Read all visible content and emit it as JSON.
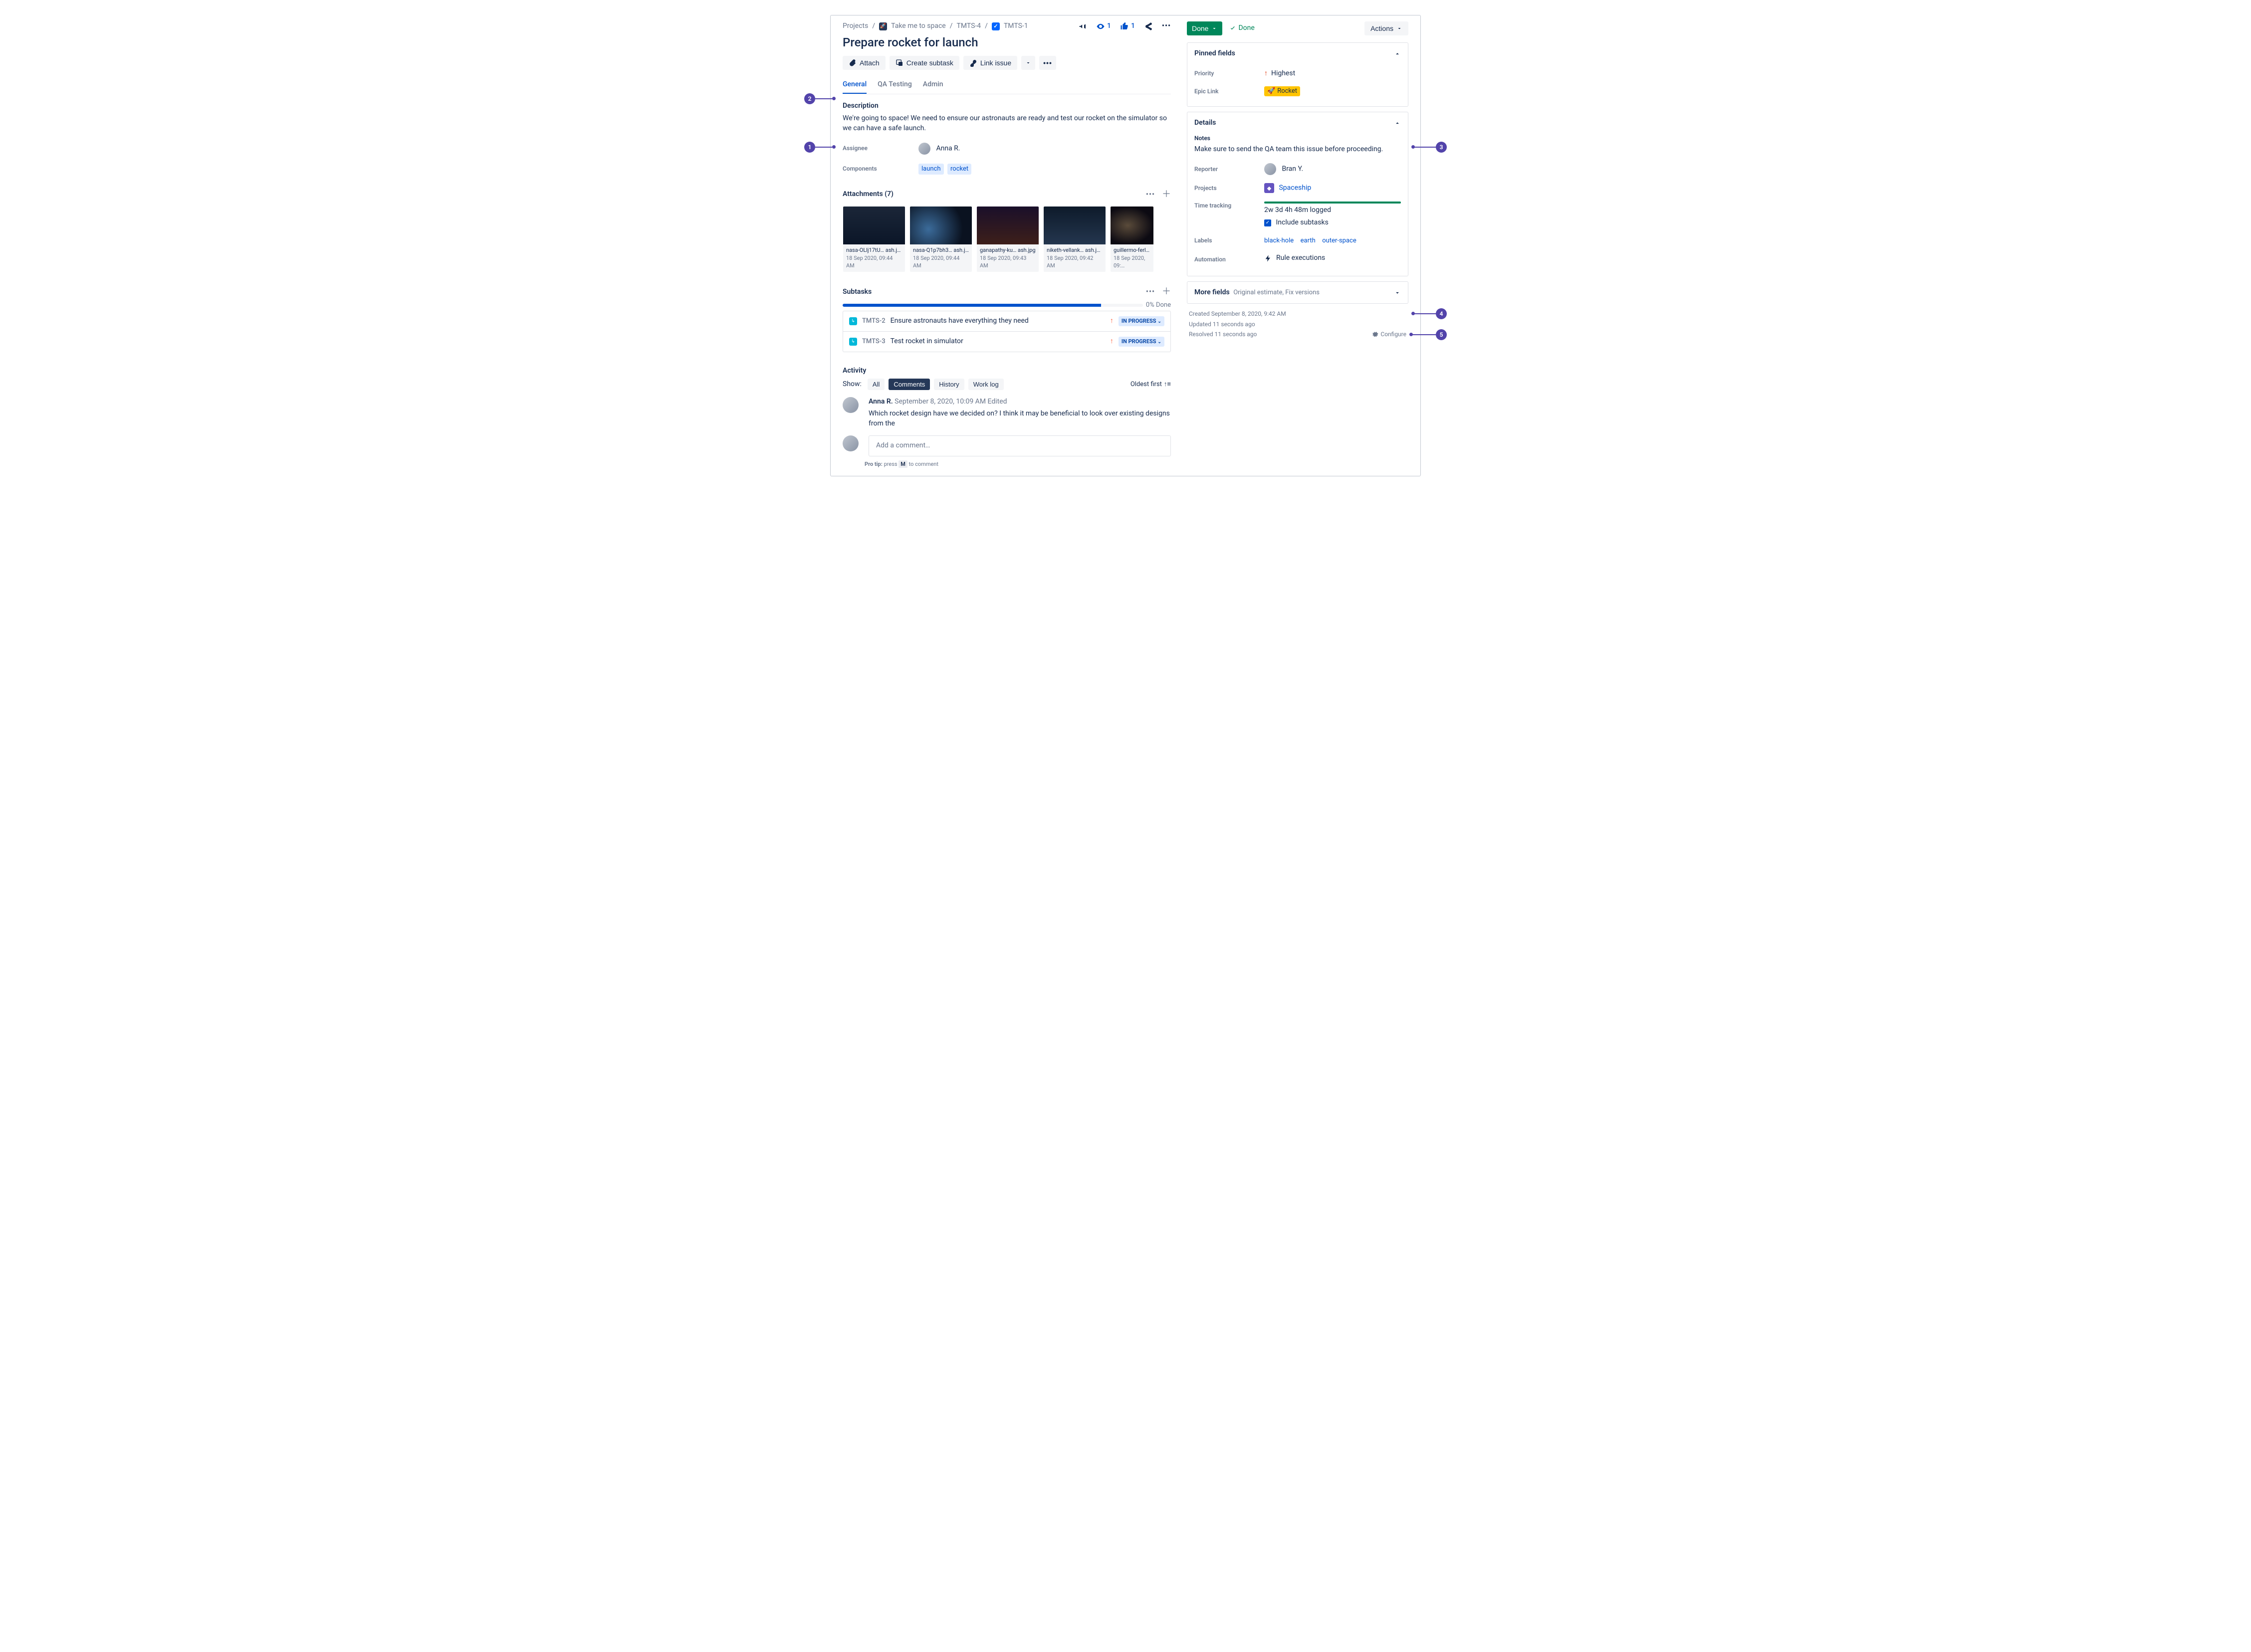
{
  "breadcrumbs": {
    "project_label": "Projects",
    "project_name": "Take me to space",
    "parent_key": "TMTS-4",
    "issue_key": "TMTS-1"
  },
  "header_actions": {
    "watchers": "1",
    "votes": "1"
  },
  "issue": {
    "title": "Prepare rocket for launch"
  },
  "toolbar": {
    "attach": "Attach",
    "create_subtask": "Create subtask",
    "link_issue": "Link issue"
  },
  "tabs": {
    "general": "General",
    "qa": "QA Testing",
    "admin": "Admin"
  },
  "description": {
    "heading": "Description",
    "body": "We're going to space! We need to ensure our astronauts are ready and test our rocket on the simulator so we can have a safe launch."
  },
  "fields": {
    "assignee_label": "Assignee",
    "assignee_value": "Anna R.",
    "components_label": "Components",
    "components": [
      "launch",
      "rocket"
    ]
  },
  "attachments": {
    "heading": "Attachments (7)",
    "items": [
      {
        "filename": "nasa-OLlj17tU… ash.jpg",
        "time": "18 Sep 2020, 09:44 AM"
      },
      {
        "filename": "nasa-Q1p7bh3… ash.jpg",
        "time": "18 Sep 2020, 09:44 AM"
      },
      {
        "filename": "ganapathy-ku… ash.jpg",
        "time": "18 Sep 2020, 09:43 AM"
      },
      {
        "filename": "niketh-vellank… ash.jpg",
        "time": "18 Sep 2020, 09:42 AM"
      },
      {
        "filename": "guillermo-ferl… a…",
        "time": "18 Sep 2020, 09:…"
      }
    ]
  },
  "subtasks": {
    "heading": "Subtasks",
    "done_pct": "0% Done",
    "items": [
      {
        "key": "TMTS-2",
        "title": "Ensure astronauts have everything they need",
        "status": "IN PROGRESS"
      },
      {
        "key": "TMTS-3",
        "title": "Test rocket in simulator",
        "status": "IN PROGRESS"
      }
    ]
  },
  "activity": {
    "heading": "Activity",
    "show_label": "Show:",
    "filters": {
      "all": "All",
      "comments": "Comments",
      "history": "History",
      "worklog": "Work log"
    },
    "sort": "Oldest first",
    "comment": {
      "author": "Anna R.",
      "meta": "September 8, 2020, 10:09 AM",
      "edited": "Edited",
      "body": "Which rocket design have we decided on? I think it may be beneficial to look over existing designs from the"
    },
    "add_placeholder": "Add a comment…",
    "protip_prefix": "Pro tip:",
    "protip_mid": "press",
    "protip_key": "M",
    "protip_suffix": "to comment"
  },
  "status": {
    "button": "Done",
    "resolved": "Done",
    "actions": "Actions"
  },
  "pinned": {
    "heading": "Pinned fields",
    "priority_label": "Priority",
    "priority_value": "Highest",
    "epic_label": "Epic Link",
    "epic_value": "Rocket"
  },
  "details": {
    "heading": "Details",
    "notes_heading": "Notes",
    "notes_body": "Make sure to send the QA team this issue before proceeding.",
    "reporter_label": "Reporter",
    "reporter_value": "Bran Y.",
    "projects_label": "Projects",
    "projects_value": "Spaceship",
    "tt_label": "Time tracking",
    "tt_value": "2w 3d 4h 48m logged",
    "tt_include": "Include subtasks",
    "labels_label": "Labels",
    "labels": [
      "black-hole",
      "earth",
      "outer-space"
    ],
    "automation_label": "Automation",
    "automation_value": "Rule executions"
  },
  "more_fields": {
    "heading": "More fields",
    "hint": "Original estimate, Fix versions"
  },
  "timestamps": {
    "created": "Created September 8, 2020, 9:42 AM",
    "updated": "Updated 11 seconds ago",
    "resolved": "Resolved 11 seconds ago",
    "configure": "Configure"
  },
  "callouts": {
    "c1": "1",
    "c2": "2",
    "c3": "3",
    "c4": "4",
    "c5": "5"
  }
}
